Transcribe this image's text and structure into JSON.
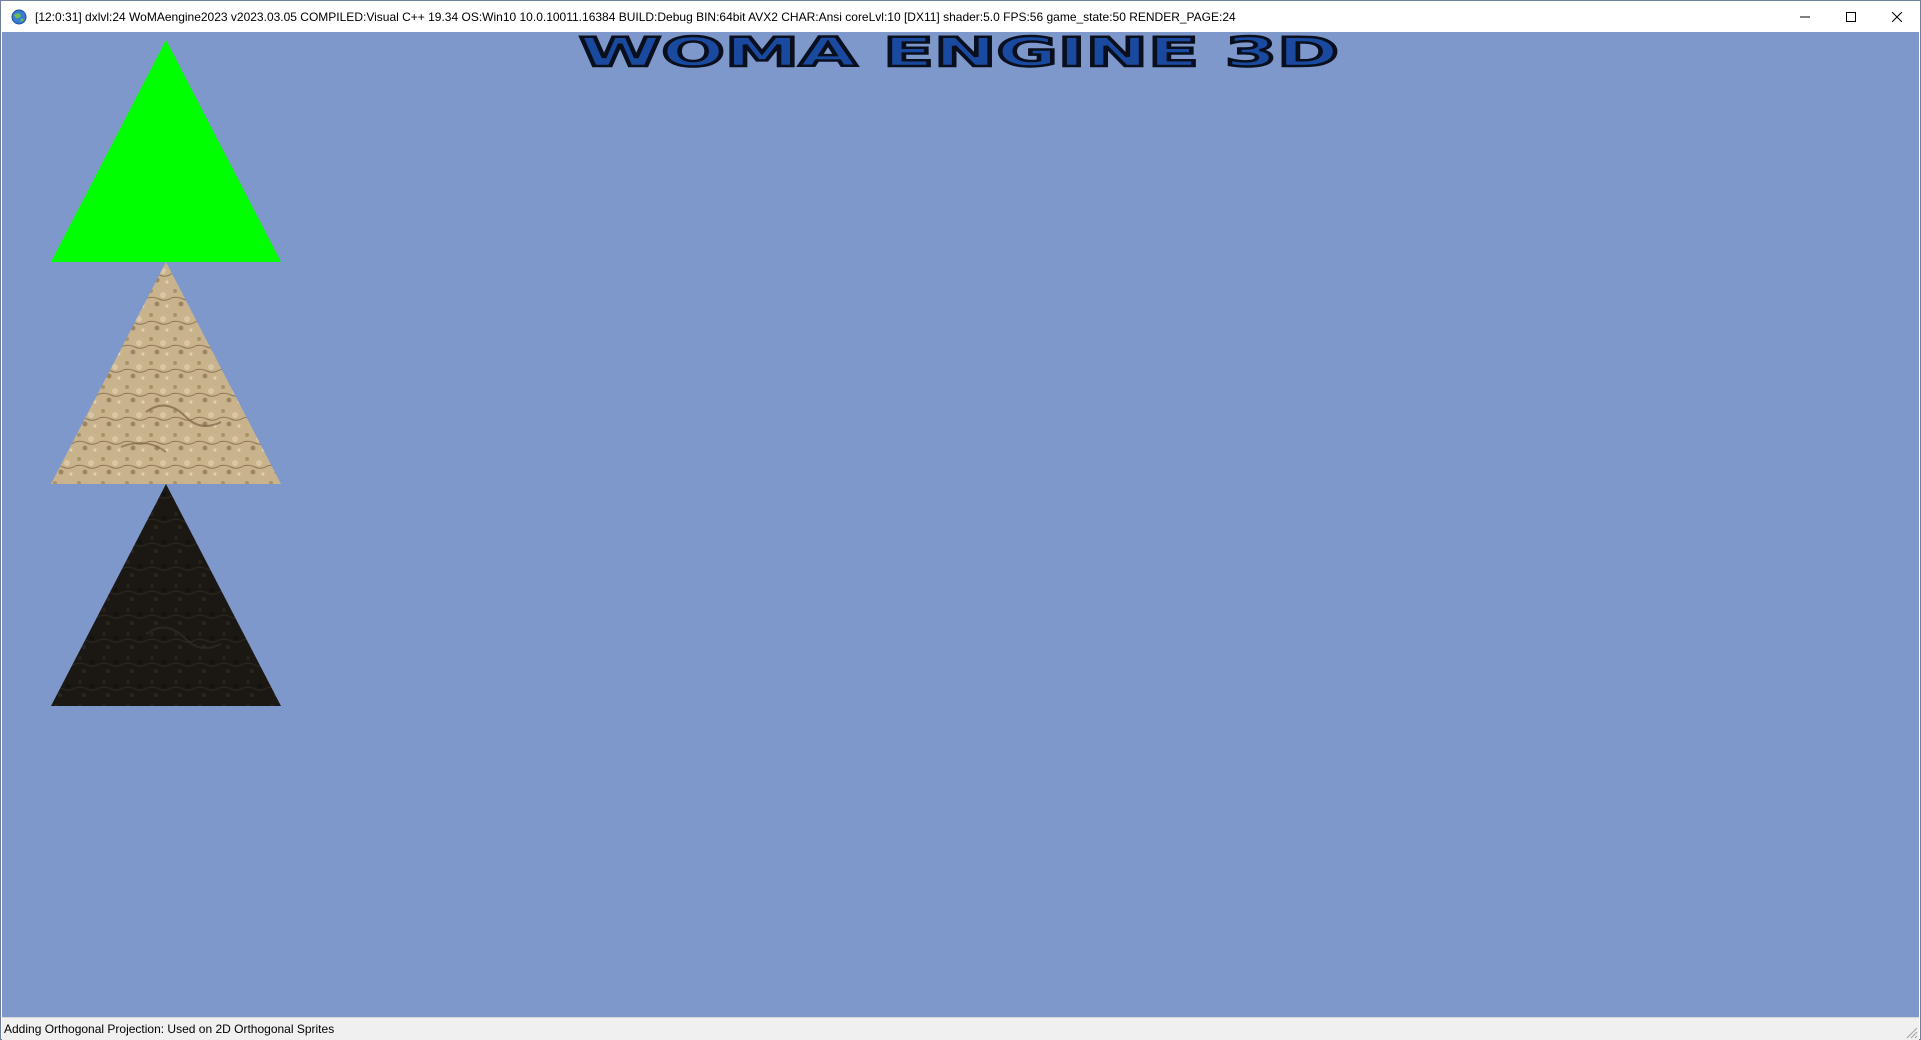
{
  "window": {
    "title": "[12:0:31] dxlvl:24 WoMAengine2023 v2023.03.05 COMPILED:Visual C++ 19.34 OS:Win10 10.0.10011.16384 BUILD:Debug BIN:64bit AVX2 CHAR:Ansi coreLvl:10 [DX11] shader:5.0 FPS:56 game_state:50 RENDER_PAGE:24",
    "icon": "globe-icon",
    "controls": [
      "minimize-icon",
      "maximize-icon",
      "close-icon"
    ]
  },
  "scene": {
    "background_color": "#7f98cb",
    "logo_text": "WOMA ENGINE 3D",
    "logo_color": "#1a4aa0",
    "sprites": [
      {
        "name": "green-triangle",
        "fill": "#00ff00"
      },
      {
        "name": "sand-textured-triangle",
        "fill": "#c8b08a"
      },
      {
        "name": "dark-textured-triangle",
        "fill": "#1a1712"
      }
    ]
  },
  "statusbar": {
    "text": "Adding Orthogonal Projection: Used on 2D Orthogonal Sprites"
  }
}
